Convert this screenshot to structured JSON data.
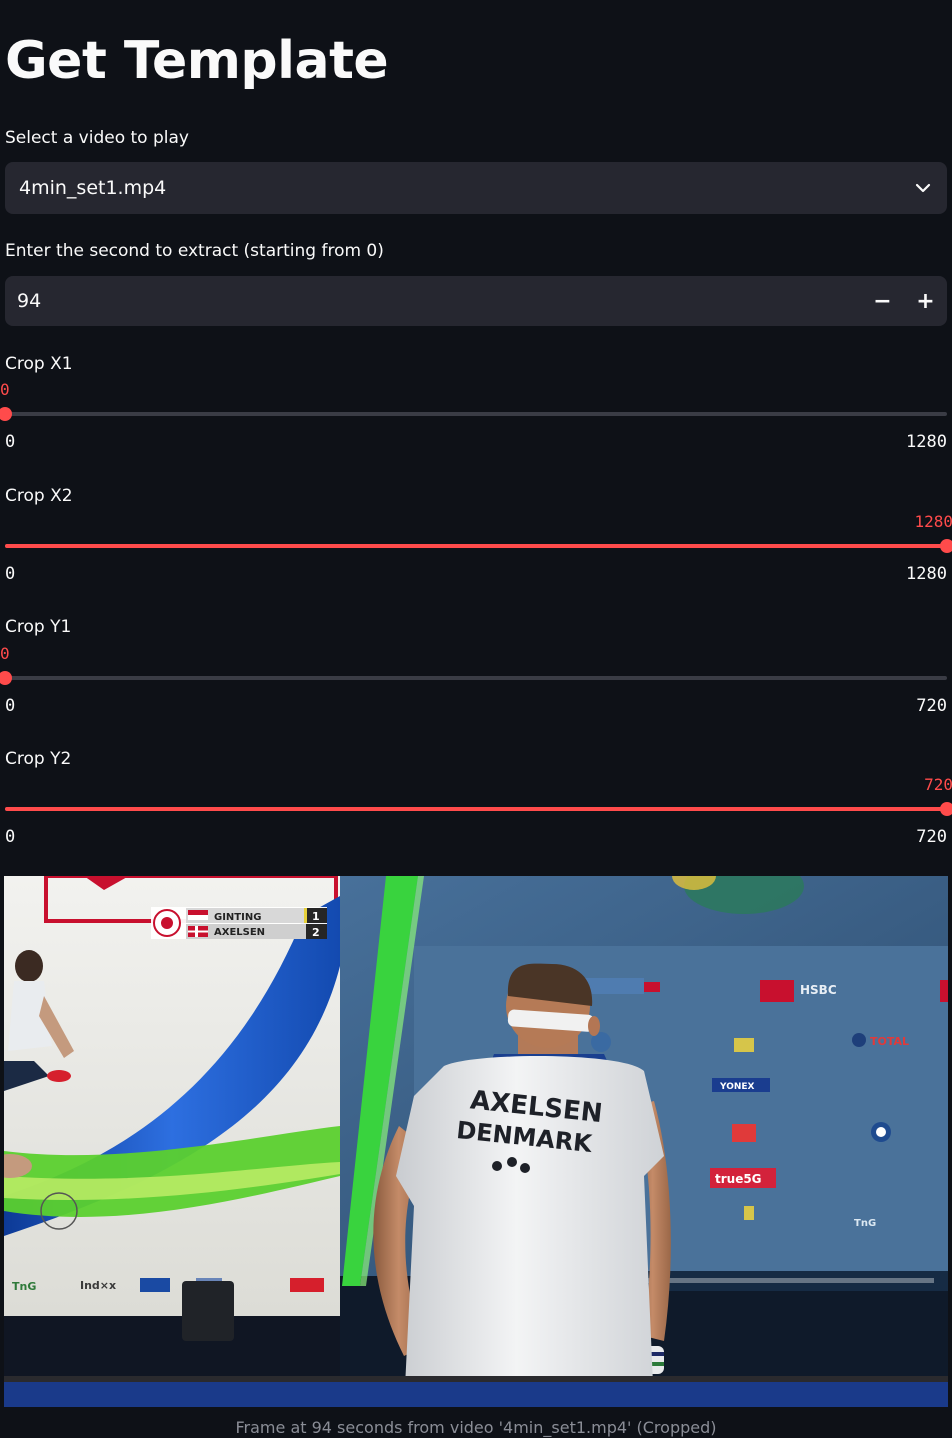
{
  "page_title": "Get Template",
  "video_select": {
    "label": "Select a video to play",
    "value": "4min_set1.mp4"
  },
  "second_input": {
    "label": "Enter the second to extract (starting from 0)",
    "value": "94",
    "minus": "−",
    "plus": "+"
  },
  "sliders": [
    {
      "label": "Crop X1",
      "value": "0",
      "min": "0",
      "max": "1280",
      "fraction": 0.0
    },
    {
      "label": "Crop X2",
      "value": "1280",
      "min": "0",
      "max": "1280",
      "fraction": 1.0
    },
    {
      "label": "Crop Y1",
      "value": "0",
      "min": "0",
      "max": "720",
      "fraction": 0.0
    },
    {
      "label": "Crop Y2",
      "value": "720",
      "min": "0",
      "max": "720",
      "fraction": 1.0
    }
  ],
  "frame": {
    "scoreboard": {
      "player1": "GINTING",
      "score1": "1",
      "player2": "AXELSEN",
      "score2": "2"
    },
    "shirt_line1": "AXELSEN",
    "shirt_line2": "DENMARK",
    "sponsors": {
      "hsbc": "HSBC",
      "total": "TOTAL",
      "yonex": "YONEX",
      "true5g": "true5G",
      "indx": "Ind×x",
      "tng": "TnG"
    }
  },
  "caption": "Frame at 94 seconds from video '4min_set1.mp4' (Cropped)",
  "colors": {
    "background": "#0e1117",
    "input_bg": "#262730",
    "accent": "#ff4b4b",
    "track": "#3a3c45"
  }
}
